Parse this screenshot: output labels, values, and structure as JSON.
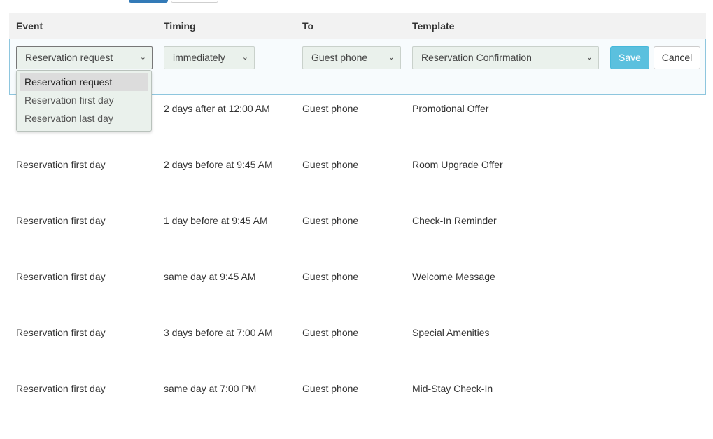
{
  "table": {
    "headers": {
      "event": "Event",
      "timing": "Timing",
      "to": "To",
      "template": "Template"
    },
    "edit_row": {
      "event": "Reservation request",
      "timing": "immediately",
      "to": "Guest phone",
      "template": "Reservation Confirmation",
      "save_label": "Save",
      "cancel_label": "Cancel"
    },
    "event_options": [
      "Reservation request",
      "Reservation first day",
      "Reservation last day"
    ],
    "rows": [
      {
        "event": "",
        "timing": "2 days after at 12:00 AM",
        "to": "Guest phone",
        "template": "Promotional Offer"
      },
      {
        "event": "Reservation first day",
        "timing": "2 days before at 9:45 AM",
        "to": "Guest phone",
        "template": "Room Upgrade Offer"
      },
      {
        "event": "Reservation first day",
        "timing": "1 day before at 9:45 AM",
        "to": "Guest phone",
        "template": "Check-In Reminder"
      },
      {
        "event": "Reservation first day",
        "timing": "same day at 9:45 AM",
        "to": "Guest phone",
        "template": "Welcome Message"
      },
      {
        "event": "Reservation first day",
        "timing": "3 days before at 7:00 AM",
        "to": "Guest phone",
        "template": "Special Amenities"
      },
      {
        "event": "Reservation first day",
        "timing": "same day at 7:00 PM",
        "to": "Guest phone",
        "template": "Mid-Stay Check-In"
      }
    ]
  },
  "colors": {
    "accent": "#5bc0de",
    "select_bg": "#eaf1ec",
    "primary": "#337ab7"
  }
}
